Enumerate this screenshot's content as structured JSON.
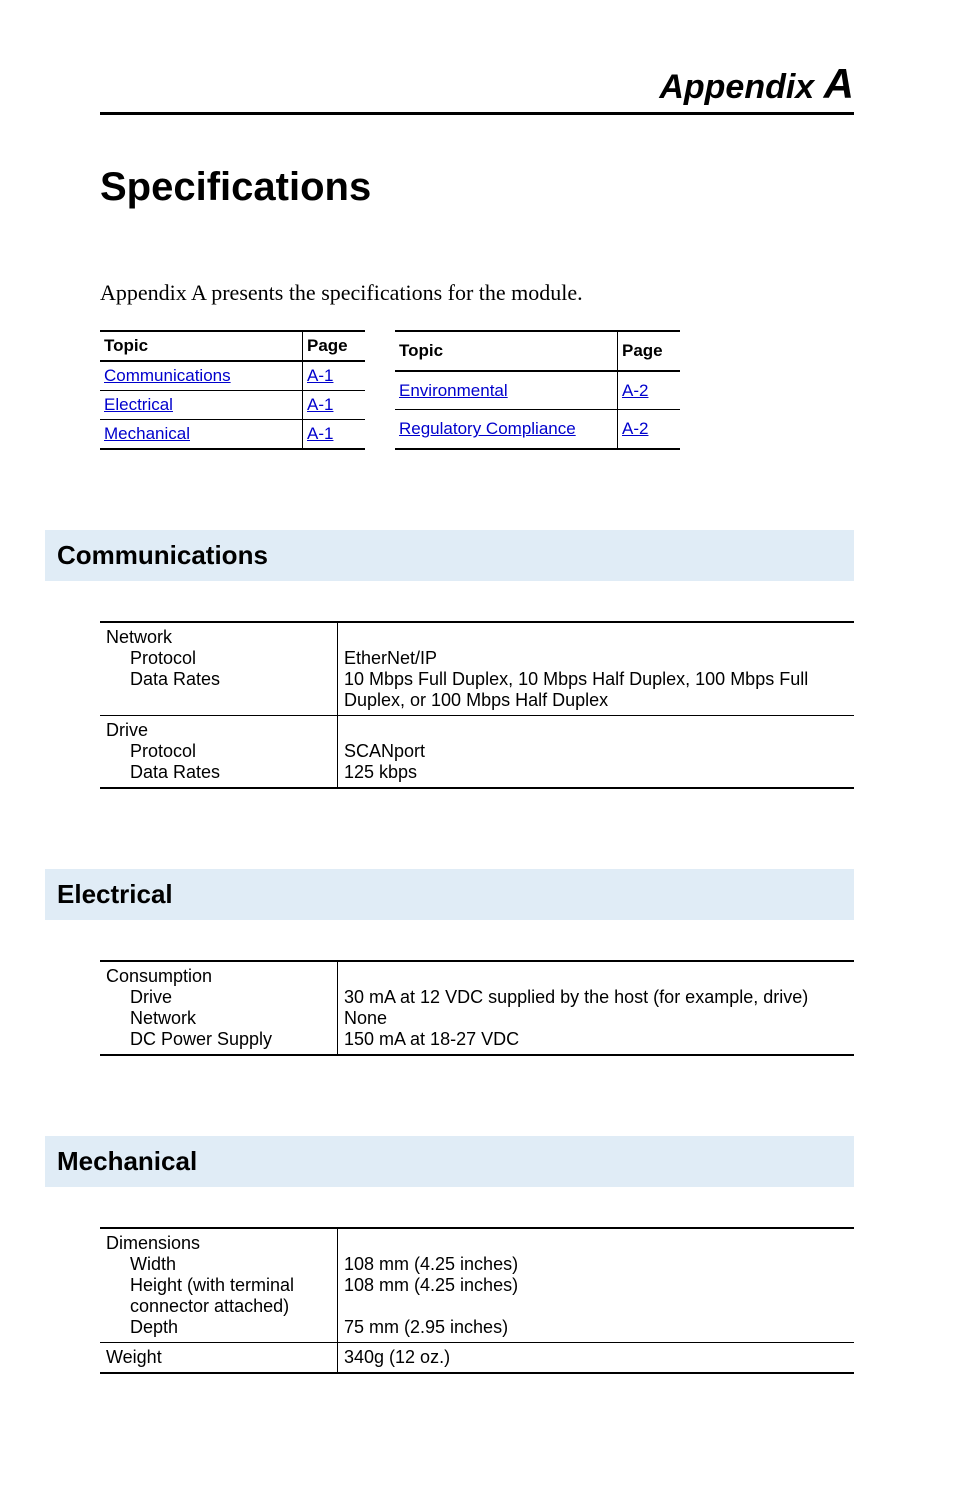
{
  "appendix": {
    "prefix": "Appendix ",
    "letter": "A"
  },
  "title": "Specifications",
  "intro": "Appendix A presents the specifications for the module.",
  "topic_tables": {
    "headers": {
      "topic": "Topic",
      "page": "Page"
    },
    "left": [
      {
        "topic": "Communications",
        "page": "A-1"
      },
      {
        "topic": "Electrical",
        "page": "A-1"
      },
      {
        "topic": "Mechanical",
        "page": "A-1"
      }
    ],
    "right": [
      {
        "topic": "Environmental",
        "page": "A-2"
      },
      {
        "topic": "Regulatory Compliance",
        "page": "A-2"
      }
    ]
  },
  "sections": {
    "communications": {
      "heading": "Communications",
      "rows": [
        {
          "label_main": "Network",
          "subs": [
            {
              "label": "Protocol",
              "value": "EtherNet/IP"
            },
            {
              "label": "Data Rates",
              "value": "10 Mbps Full Duplex, 10 Mbps Half Duplex, 100 Mbps Full Duplex, or 100 Mbps Half Duplex"
            }
          ]
        },
        {
          "label_main": "Drive",
          "subs": [
            {
              "label": "Protocol",
              "value": "SCANport"
            },
            {
              "label": "Data Rates",
              "value": "125 kbps"
            }
          ]
        }
      ]
    },
    "electrical": {
      "heading": "Electrical",
      "rows": [
        {
          "label_main": "Consumption",
          "subs": [
            {
              "label": "Drive",
              "value": "30 mA at 12 VDC supplied by the host (for example, drive)"
            },
            {
              "label": "Network",
              "value": "None"
            },
            {
              "label": "DC Power Supply",
              "value": "150 mA at 18-27 VDC"
            }
          ]
        }
      ]
    },
    "mechanical": {
      "heading": "Mechanical",
      "rows": [
        {
          "label_main": "Dimensions",
          "subs": [
            {
              "label": "Width",
              "value": "108 mm (4.25 inches)"
            },
            {
              "label": "Height (with terminal connector attached)",
              "value": "108 mm (4.25 inches)"
            },
            {
              "label": "Depth",
              "value": "75 mm (2.95 inches)"
            }
          ]
        },
        {
          "label_main": "Weight",
          "value": "340g (12 oz.)",
          "subs": []
        }
      ]
    }
  }
}
